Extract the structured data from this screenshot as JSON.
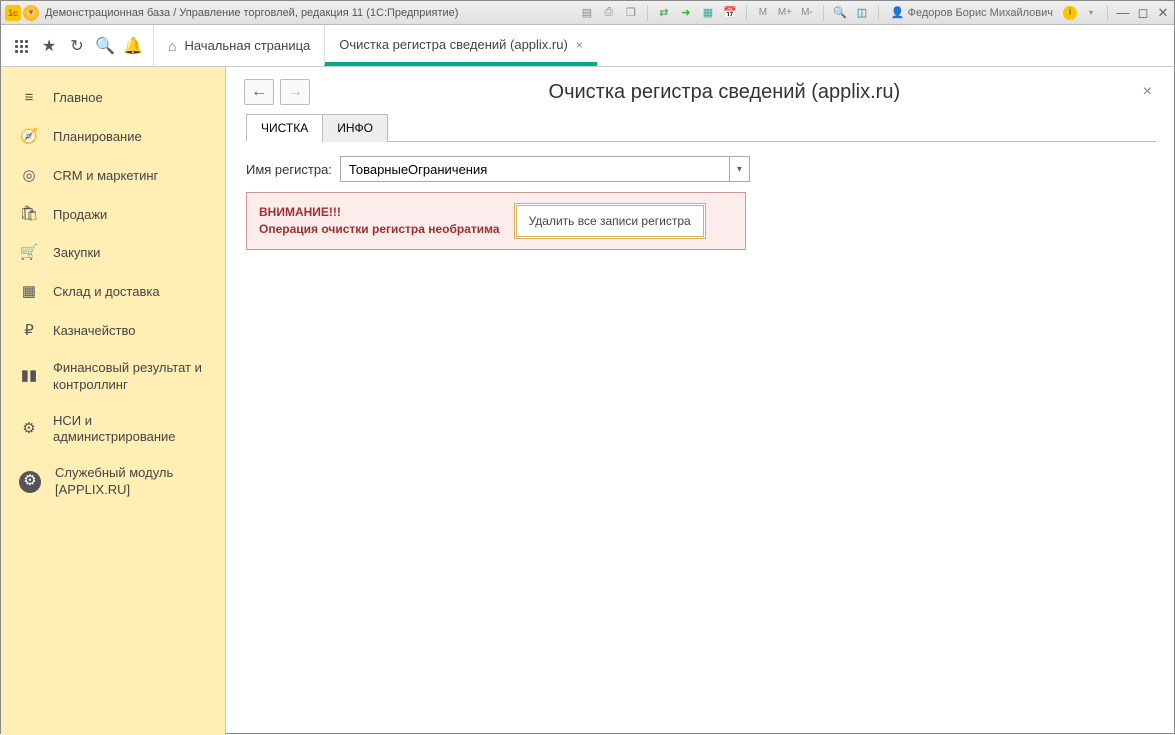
{
  "titlebar": {
    "title": "Демонстрационная база / Управление торговлей, редакция 11  (1С:Предприятие)",
    "user": "Федоров Борис Михайлович",
    "m_labels": [
      "M",
      "M+",
      "M-"
    ]
  },
  "toptabs": {
    "home": "Начальная страница",
    "active_tab": "Очистка регистра сведений (applix.ru)"
  },
  "sidebar": {
    "items": [
      {
        "icon": "menu",
        "label": "Главное"
      },
      {
        "icon": "plan",
        "label": "Планирование"
      },
      {
        "icon": "target",
        "label": "CRM и маркетинг"
      },
      {
        "icon": "bag",
        "label": "Продажи"
      },
      {
        "icon": "cart",
        "label": "Закупки"
      },
      {
        "icon": "warehouse",
        "label": "Склад и доставка"
      },
      {
        "icon": "ruble",
        "label": "Казначейство"
      },
      {
        "icon": "chart",
        "label": "Финансовый результат и контроллинг"
      },
      {
        "icon": "gear",
        "label": "НСИ и администрирование"
      },
      {
        "icon": "gear-active",
        "label": "Служебный модуль [APPLIX.RU]"
      }
    ]
  },
  "content": {
    "page_title": "Очистка регистра сведений (applix.ru)",
    "tabs": [
      "ЧИСТКА",
      "ИНФО"
    ],
    "field_label": "Имя регистра:",
    "field_value": "ТоварныеОграничения",
    "warn_line1": "ВНИМАНИЕ!!!",
    "warn_line2": "Операция очистки регистра необратима",
    "warn_button": "Удалить все записи регистра"
  }
}
